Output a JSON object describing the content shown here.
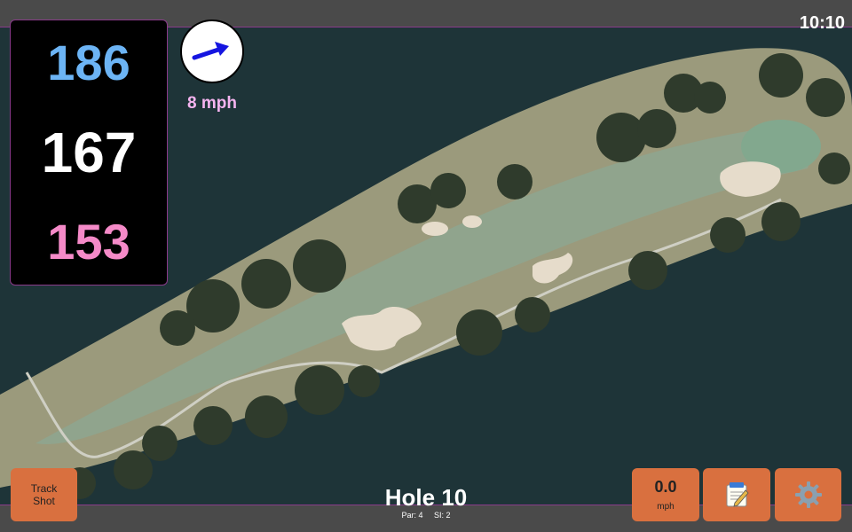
{
  "status": {
    "time": "10:10"
  },
  "yardages": {
    "back": "186",
    "middle": "167",
    "front": "153"
  },
  "wind": {
    "speed": "8 mph",
    "icon": "wind-arrow-icon"
  },
  "hole": {
    "title": "Hole 10",
    "par": "Par: 4",
    "si": "SI: 2"
  },
  "buttons": {
    "track_shot_line1": "Track",
    "track_shot_line2": "Shot",
    "speed_value": "0.0",
    "speed_unit": "mph",
    "notes_icon": "notepad-icon",
    "settings_icon": "gear-icon"
  },
  "colors": {
    "accent_orange": "#d9703f",
    "back_yardage": "#6cb4f5",
    "front_yardage": "#f58ac8",
    "wind_text": "#f5b4f0"
  }
}
